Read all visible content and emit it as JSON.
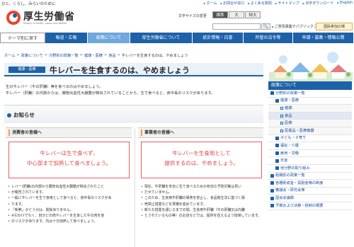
{
  "topbar": {
    "tagline": "ひと、くらし、みらいのために",
    "links": [
      "ホーム",
      "お問合せ窓口",
      "よくある質問",
      "サイトマップ",
      "点字ダウンロード",
      "English"
    ]
  },
  "header": {
    "title": "厚生労働省",
    "subtitle": "Ministry of Health, Labour and Welfare",
    "font_size_label": "文字サイズの変更",
    "font_sizes": [
      "標準",
      "大",
      "特大"
    ],
    "search_button": "🔍",
    "opinion_link": "ご意見募集やパブリックコメントはこちら",
    "national_btn": "国民参加の場"
  },
  "gnav": [
    {
      "label": "テーマ別に探す"
    },
    {
      "label": "報道・広報"
    },
    {
      "label": "政策について"
    },
    {
      "label": "厚生労働省について"
    },
    {
      "label": "統計情報・白書"
    },
    {
      "label": "所管の法令等"
    },
    {
      "label": "申請・募集・情報公開"
    }
  ],
  "breadcrumb": [
    "ホーム",
    "政策について",
    "分野別の政策一覧",
    "健康・医療",
    "食品",
    "牛レバーを生食するのは、やめましょう"
  ],
  "page": {
    "category": "健康・医療",
    "title": "牛レバーを生食するのは、やめましょう",
    "intro1": "生の牛レバー（牛の肝臓）等を食べるのはやめましょう。",
    "intro2": "牛レバー（肝臓）の内部からは、腸管出血性大腸菌が検出されていることから、生で食べると、食中毒のリスクがあります。"
  },
  "notice": {
    "heading": "お知らせ",
    "consumer_heading": "消費者の皆様へ",
    "business_heading": "事業者の皆様へ",
    "consumer_alert_1": "牛レバーは生で食べず、",
    "consumer_alert_2": "中心部まで加熱して食べましょう。",
    "business_alert_1": "牛レバーを生食用として",
    "business_alert_2": "提供するのは、やめましょう。",
    "consumer_bullets": [
      "レバー(肝臓)の内部から腸管出血性大腸菌が検出されたこと",
      "が報告されています。",
      "一般に牛レバーを生で食用として食べると、食中毒のリスクがあ",
      "ります。",
      "「新鮮」かどうかは、関係ありません。",
      "※引かけでなく、自分どの肉やレバーを生食した牛の肉を食",
      "のリスクがあります。内は十分加熱して食べましょう。"
    ],
    "business_bullets": [
      "現在、牛肝臓を安全に生で食べるための有効な予防対策は見い",
      "だせていません。",
      "このため、生食用牛肝臓の販売を禁止し、食品衛生法に基づく販",
      "売禁止措置などを準備を進めています。",
      "新たな措置を講じるまでの間、生食用牛肝臓（牛の肝臓又は内臓",
      "とされているもの等）のお店などでは、提供を控えるよう指導しています。"
    ]
  },
  "sidebar": {
    "heading": "政策について",
    "items": [
      {
        "label": "分野別の政策一覧",
        "level": 1
      },
      {
        "label": "健康・医療",
        "level": 2
      },
      {
        "label": "健康",
        "level": 3
      },
      {
        "label": "食品",
        "level": 3
      },
      {
        "label": "医療",
        "level": 3
      },
      {
        "label": "医薬品・医療機器",
        "level": 3
      },
      {
        "label": "子ども・子育て",
        "level": 2
      },
      {
        "label": "福祉・介護",
        "level": 2
      },
      {
        "label": "雇用・労働",
        "level": 2
      },
      {
        "label": "年金",
        "level": 2
      },
      {
        "label": "他分野の取り組み",
        "level": 2
      },
      {
        "label": "組織別の政策一覧",
        "level": 1
      },
      {
        "label": "各種助成金・奨励金等の制度",
        "level": 1
      },
      {
        "label": "審議会・研究会等",
        "level": 1
      },
      {
        "label": "国会会議録",
        "level": 1
      },
      {
        "label": "予算および決算・税制の概要",
        "level": 1
      }
    ]
  },
  "colors": {
    "primary": "#1d61a8",
    "accent": "#6fa8dc",
    "alert": "#e04040"
  }
}
